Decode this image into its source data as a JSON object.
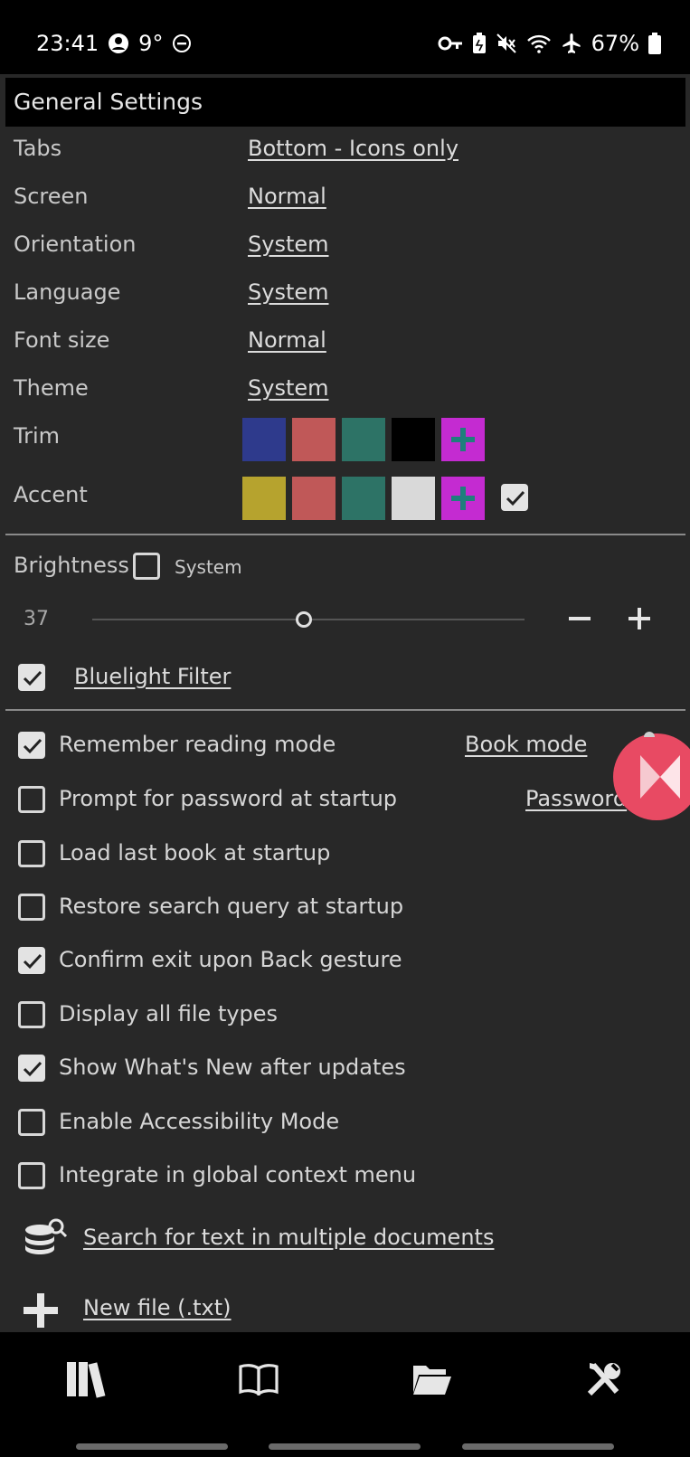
{
  "status_bar": {
    "time": "23:41",
    "temperature": "9°",
    "battery": "67%",
    "icons": [
      "person-circle-icon",
      "minus-circle-icon",
      "key-icon",
      "battery-saver-icon",
      "mute-icon",
      "wifi-icon",
      "airplane-icon",
      "battery-icon"
    ]
  },
  "header": {
    "title": "General Settings"
  },
  "settings": {
    "tabs": {
      "label": "Tabs",
      "value": "Bottom - Icons only"
    },
    "screen": {
      "label": "Screen",
      "value": "Normal"
    },
    "orientation": {
      "label": "Orientation",
      "value": "System"
    },
    "language": {
      "label": "Language",
      "value": "System"
    },
    "font_size": {
      "label": "Font size",
      "value": "Normal"
    },
    "theme": {
      "label": "Theme",
      "value": "System"
    }
  },
  "trim": {
    "label": "Trim",
    "colors": [
      "#2e3a8c",
      "#c05858",
      "#2d7366",
      "#000000"
    ],
    "add_color": "#c42bd1"
  },
  "accent": {
    "label": "Accent",
    "colors": [
      "#b6a32e",
      "#c05858",
      "#2d7366",
      "#d9d9d9"
    ],
    "add_color": "#c42bd1",
    "checked": true
  },
  "brightness": {
    "label": "Brightness",
    "system_label": "System",
    "system_checked": false,
    "value": "37",
    "fraction": 0.49
  },
  "bluelight": {
    "label": "Bluelight Filter",
    "checked": true
  },
  "options": [
    {
      "label": "Remember reading mode",
      "checked": true,
      "link": "Book mode"
    },
    {
      "label": "Prompt for password at startup",
      "checked": false,
      "link": "Password"
    },
    {
      "label": "Load last book at startup",
      "checked": false
    },
    {
      "label": "Restore search query at startup",
      "checked": false
    },
    {
      "label": "Confirm exit upon Back gesture",
      "checked": true
    },
    {
      "label": "Display all file types",
      "checked": false
    },
    {
      "label": "Show What's New after updates",
      "checked": true
    },
    {
      "label": "Enable Accessibility Mode",
      "checked": false
    },
    {
      "label": "Integrate in global context menu",
      "checked": false
    }
  ],
  "actions": {
    "search_docs": "Search for text in multiple documents",
    "new_file": "New file (.txt)"
  },
  "bottom_nav": [
    "library-icon",
    "book-icon",
    "folder-icon",
    "tools-icon"
  ]
}
